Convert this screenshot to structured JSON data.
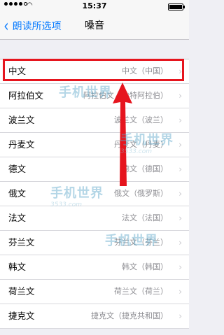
{
  "status_bar": {
    "time": "15:37"
  },
  "nav": {
    "back_label": "朗读所选项",
    "title": "嗓音"
  },
  "rows": [
    {
      "label": "中文",
      "value": "中文（中国）"
    },
    {
      "label": "阿拉伯文",
      "value": "阿拉伯文（沙特阿拉伯）"
    },
    {
      "label": "波兰文",
      "value": "波兰文（波兰）"
    },
    {
      "label": "丹麦文",
      "value": "丹麦文（丹麦）"
    },
    {
      "label": "德文",
      "value": "德文（德国）"
    },
    {
      "label": "俄文",
      "value": "俄文（俄罗斯）"
    },
    {
      "label": "法文",
      "value": "法文（法国）"
    },
    {
      "label": "芬兰文",
      "value": "芬兰文（芬兰）"
    },
    {
      "label": "韩文",
      "value": "韩文（韩国）"
    },
    {
      "label": "荷兰文",
      "value": "荷兰文（荷兰）"
    },
    {
      "label": "捷克文",
      "value": "捷克文（捷克共和国）"
    }
  ],
  "watermark": {
    "text": "手机世界",
    "sub": "3533.com"
  },
  "colors": {
    "accent": "#0a7cff",
    "highlight": "#e6151e"
  },
  "battery_level": 1.0
}
